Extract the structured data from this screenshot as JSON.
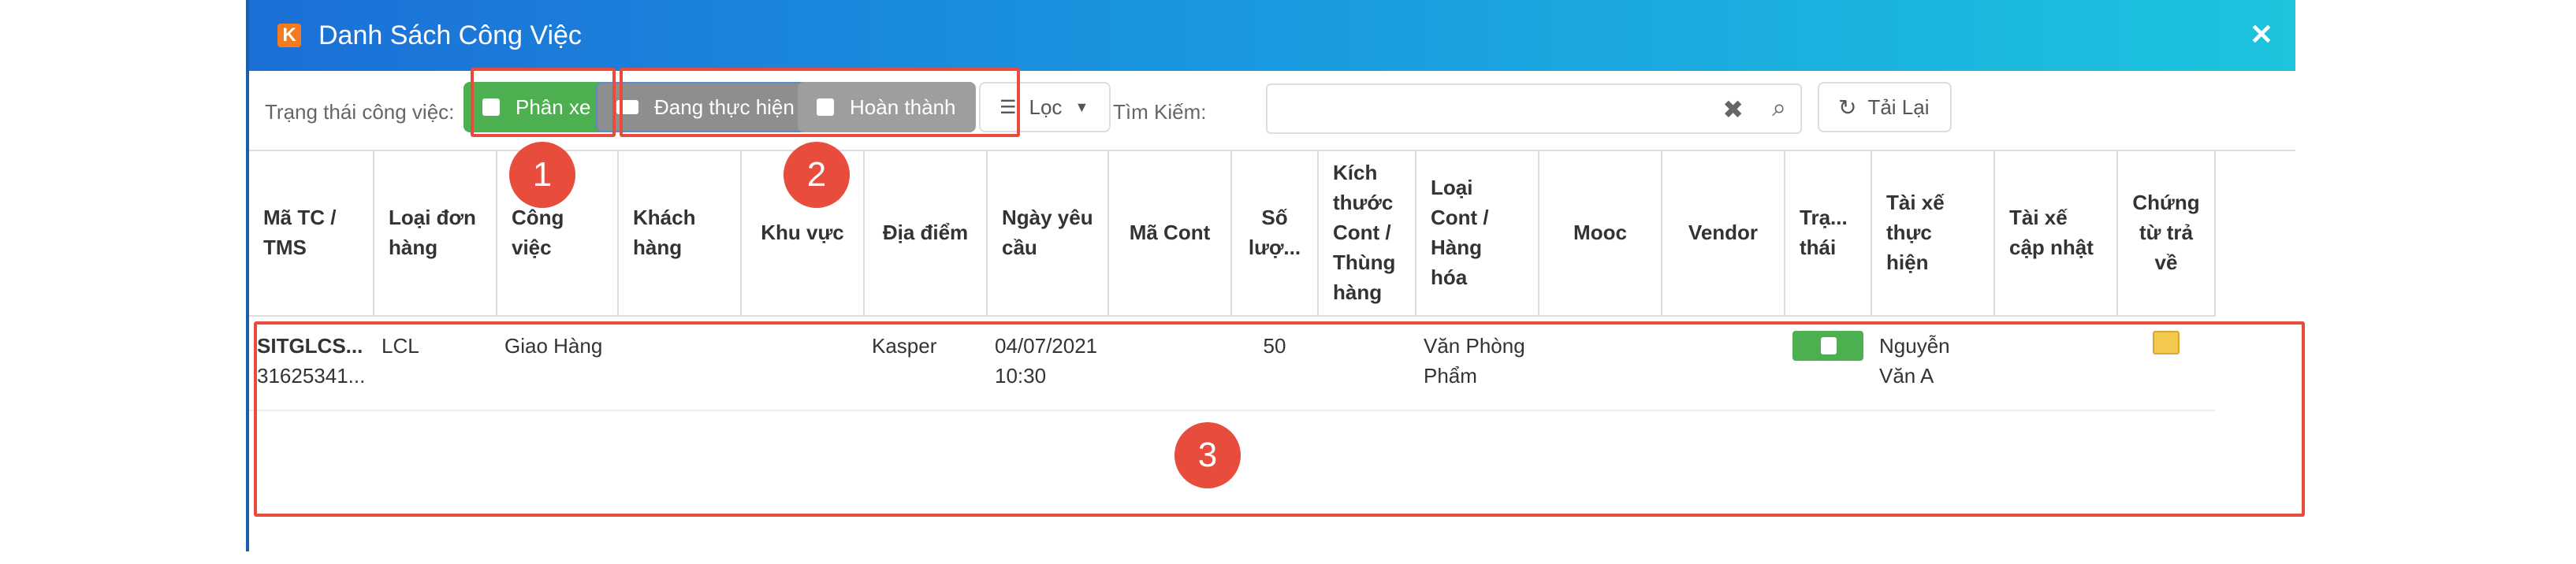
{
  "window": {
    "title": "Danh Sách Công Việc",
    "logo": "K"
  },
  "toolbar": {
    "status_label": "Trạng thái công việc:",
    "btn_assign": "Phân xe",
    "btn_in_progress": "Đang thực hiện",
    "btn_done": "Hoàn thành",
    "filter_label": "Lọc",
    "search_label": "Tìm Kiếm:",
    "search_value": "",
    "reload_label": "Tải Lại"
  },
  "table": {
    "headers": [
      "Mã TC / TMS",
      "Loại đơn hàng",
      "Công việc",
      "Khách hàng",
      "Khu vực",
      "Địa điểm",
      "Ngày yêu cầu",
      "Mã Cont",
      "Số lượ...",
      "Kích thước Cont / Thùng hàng",
      "Loại Cont / Hàng hóa",
      "Mooc",
      "Vendor",
      "Trạ... thái",
      "Tài xế thực hiện",
      "Tài xế cập nhật",
      "Chứng từ trả về"
    ],
    "rows": [
      {
        "code": "SITGLCS...",
        "code2": "31625341...",
        "order_type": "LCL",
        "job": "Giao Hàng",
        "customer": "",
        "region": "",
        "location": "Kasper",
        "date": "04/07/2021",
        "time": "10:30",
        "cont": "",
        "qty": "50",
        "size": "",
        "cargo": "Văn Phòng Phẩm",
        "mooc": "",
        "vendor": "",
        "driver": "Nguyễn Văn A",
        "driver_update": ""
      }
    ]
  },
  "annotations": [
    "1",
    "2",
    "3"
  ],
  "colors": {
    "accent_green": "#4caf50",
    "marker_red": "#e74c3c",
    "title_start": "#1b6fd6",
    "title_end": "#1cc4dd"
  }
}
